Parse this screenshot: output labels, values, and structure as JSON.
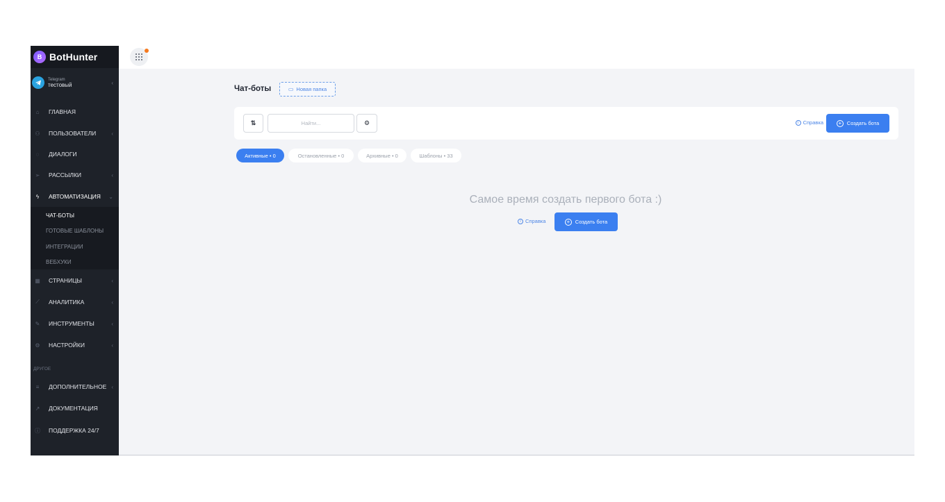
{
  "brand": {
    "name": "BotHunter"
  },
  "account": {
    "platform": "Telegram",
    "name": "тестовый"
  },
  "sidebar": {
    "items": [
      {
        "label": "ГЛАВНАЯ"
      },
      {
        "label": "ПОЛЬЗОВАТЕЛИ"
      },
      {
        "label": "ДИАЛОГИ"
      },
      {
        "label": "РАССЫЛКИ"
      },
      {
        "label": "АВТОМАТИЗАЦИЯ"
      },
      {
        "label": "СТРАНИЦЫ"
      },
      {
        "label": "АНАЛИТИКА"
      },
      {
        "label": "ИНСТРУМЕНТЫ"
      },
      {
        "label": "НАСТРОЙКИ"
      }
    ],
    "submenu": [
      {
        "label": "ЧАТ-БОТЫ"
      },
      {
        "label": "ГОТОВЫЕ ШАБЛОНЫ"
      },
      {
        "label": "ИНТЕГРАЦИИ"
      },
      {
        "label": "ВЕБХУКИ"
      }
    ],
    "section_other": "ДРУГОЕ",
    "other_items": [
      {
        "label": "ДОПОЛНИТЕЛЬНОЕ"
      },
      {
        "label": "ДОКУМЕНТАЦИЯ"
      },
      {
        "label": "ПОДДЕРЖКА 24/7"
      }
    ]
  },
  "main": {
    "title": "Чат-боты",
    "new_folder": "Новая папка",
    "search_placeholder": "Найти...",
    "help": "Справка",
    "create_bot": "Создать бота",
    "tabs": [
      {
        "label": "Активные • 0"
      },
      {
        "label": "Остановленные • 0"
      },
      {
        "label": "Архивные • 0"
      },
      {
        "label": "Шаблоны • 33"
      }
    ],
    "empty_title": "Самое время создать первого бота :)",
    "empty_help": "Справка",
    "empty_create": "Создать бота"
  },
  "colors": {
    "accent": "#3b7ff0",
    "sidebar": "#1e2229",
    "notification": "#f57a1f"
  }
}
